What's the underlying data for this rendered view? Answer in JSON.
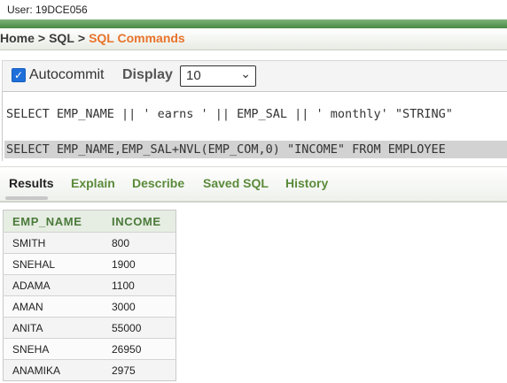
{
  "user": "User: 19DCE056",
  "breadcrumb": {
    "home": "Home",
    "sql": "SQL",
    "current": "SQL Commands",
    "sep": ">"
  },
  "toolbar": {
    "autocommit_label": "Autocommit",
    "autocommit_checked": true,
    "display_label": "Display",
    "display_value": "10"
  },
  "editor": {
    "line1": "SELECT EMP_NAME || ' earns ' || EMP_SAL || ' monthly' \"STRING\"",
    "line2": "SELECT EMP_NAME,EMP_SAL+NVL(EMP_COM,0) \"INCOME\" FROM EMPLOYEE"
  },
  "tabs": [
    "Results",
    "Explain",
    "Describe",
    "Saved SQL",
    "History"
  ],
  "results": {
    "columns": [
      "EMP_NAME",
      "INCOME"
    ],
    "rows": [
      [
        "SMITH",
        "800"
      ],
      [
        "SNEHAL",
        "1900"
      ],
      [
        "ADAMA",
        "1100"
      ],
      [
        "AMAN",
        "3000"
      ],
      [
        "ANITA",
        "55000"
      ],
      [
        "SNEHA",
        "26950"
      ],
      [
        "ANAMIKA",
        "2975"
      ]
    ]
  },
  "colors": {
    "accent": "#e8732b",
    "link": "#5b8a3a",
    "header_bar": "#4a8a46"
  }
}
